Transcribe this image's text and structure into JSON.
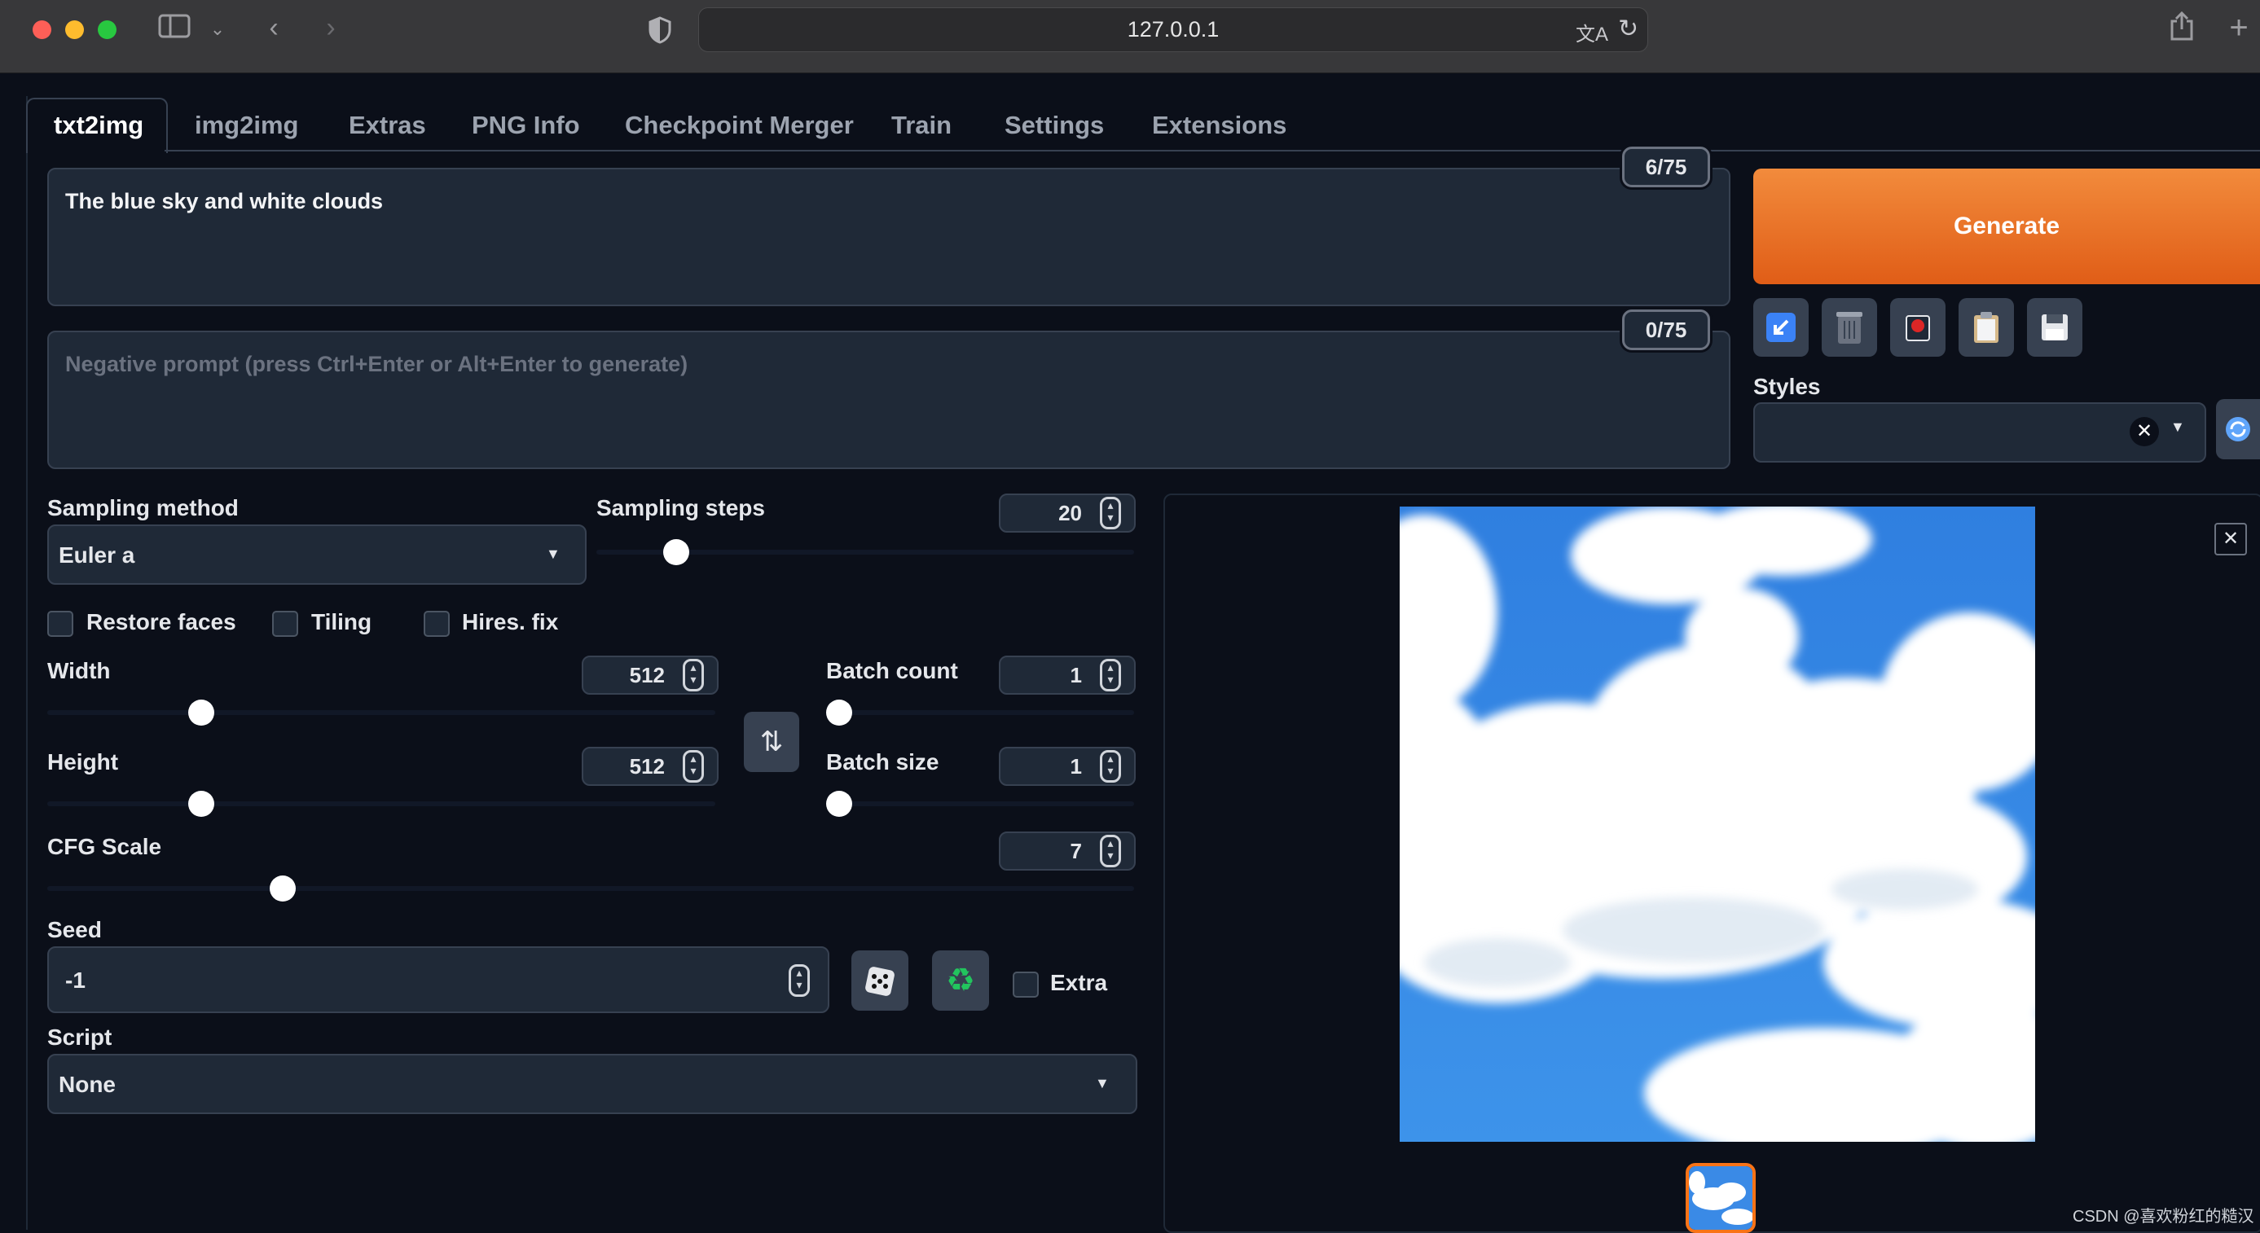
{
  "browser": {
    "url": "127.0.0.1"
  },
  "tabs": [
    "txt2img",
    "img2img",
    "Extras",
    "PNG Info",
    "Checkpoint Merger",
    "Train",
    "Settings",
    "Extensions"
  ],
  "prompt": {
    "value": "The blue sky and white clouds",
    "token_count": "6/75"
  },
  "negative_prompt": {
    "placeholder": "Negative prompt (press Ctrl+Enter or Alt+Enter to generate)",
    "token_count": "0/75"
  },
  "generate_label": "Generate",
  "tool_buttons": [
    "arrow-icon",
    "trash-icon",
    "red-photo-icon",
    "clipboard-icon",
    "save-icon"
  ],
  "styles": {
    "label": "Styles",
    "value": ""
  },
  "sampling": {
    "method_label": "Sampling method",
    "method_value": "Euler a",
    "steps_label": "Sampling steps",
    "steps_value": "20",
    "steps_fraction": 0.13
  },
  "checkboxes": {
    "restore_faces": "Restore faces",
    "tiling": "Tiling",
    "hires_fix": "Hires. fix"
  },
  "width": {
    "label": "Width",
    "value": "512",
    "fraction": 0.22
  },
  "height": {
    "label": "Height",
    "value": "512",
    "fraction": 0.22
  },
  "batch_count": {
    "label": "Batch count",
    "value": "1",
    "fraction": 0.0
  },
  "batch_size": {
    "label": "Batch size",
    "value": "1",
    "fraction": 0.0
  },
  "cfg_scale": {
    "label": "CFG Scale",
    "value": "7",
    "fraction": 0.21
  },
  "seed": {
    "label": "Seed",
    "value": "-1",
    "extra_label": "Extra"
  },
  "script": {
    "label": "Script",
    "value": "None"
  },
  "watermark": "CSDN @喜欢粉红的糙汉",
  "colors": {
    "background": "#0b0f19",
    "panel": "#1f2937",
    "generate": "#e8661f"
  }
}
